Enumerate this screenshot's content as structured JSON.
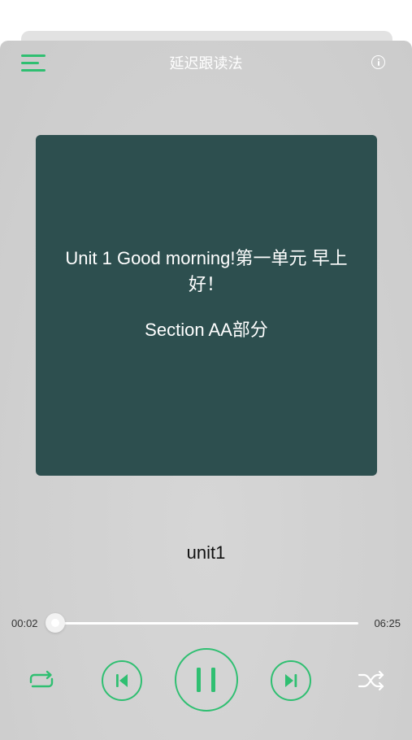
{
  "header": {
    "title": "延迟跟读法",
    "menu_icon": "menu-icon",
    "info_icon": "info-icon"
  },
  "cover": {
    "line1": "Unit 1 Good morning!第一单元 早上好！",
    "line2": "Section AA部分",
    "background": "#2d4f4f"
  },
  "track": {
    "name": "unit1"
  },
  "progress": {
    "elapsed": "00:02",
    "total": "06:25",
    "fraction": 0.005
  },
  "controls": {
    "repeat_icon": "repeat-icon",
    "previous_icon": "skip-previous-icon",
    "pause_icon": "pause-icon",
    "next_icon": "skip-next-icon",
    "shuffle_icon": "shuffle-icon"
  },
  "colors": {
    "accent": "#2fbf71",
    "sheet": "#d2d2d2"
  }
}
